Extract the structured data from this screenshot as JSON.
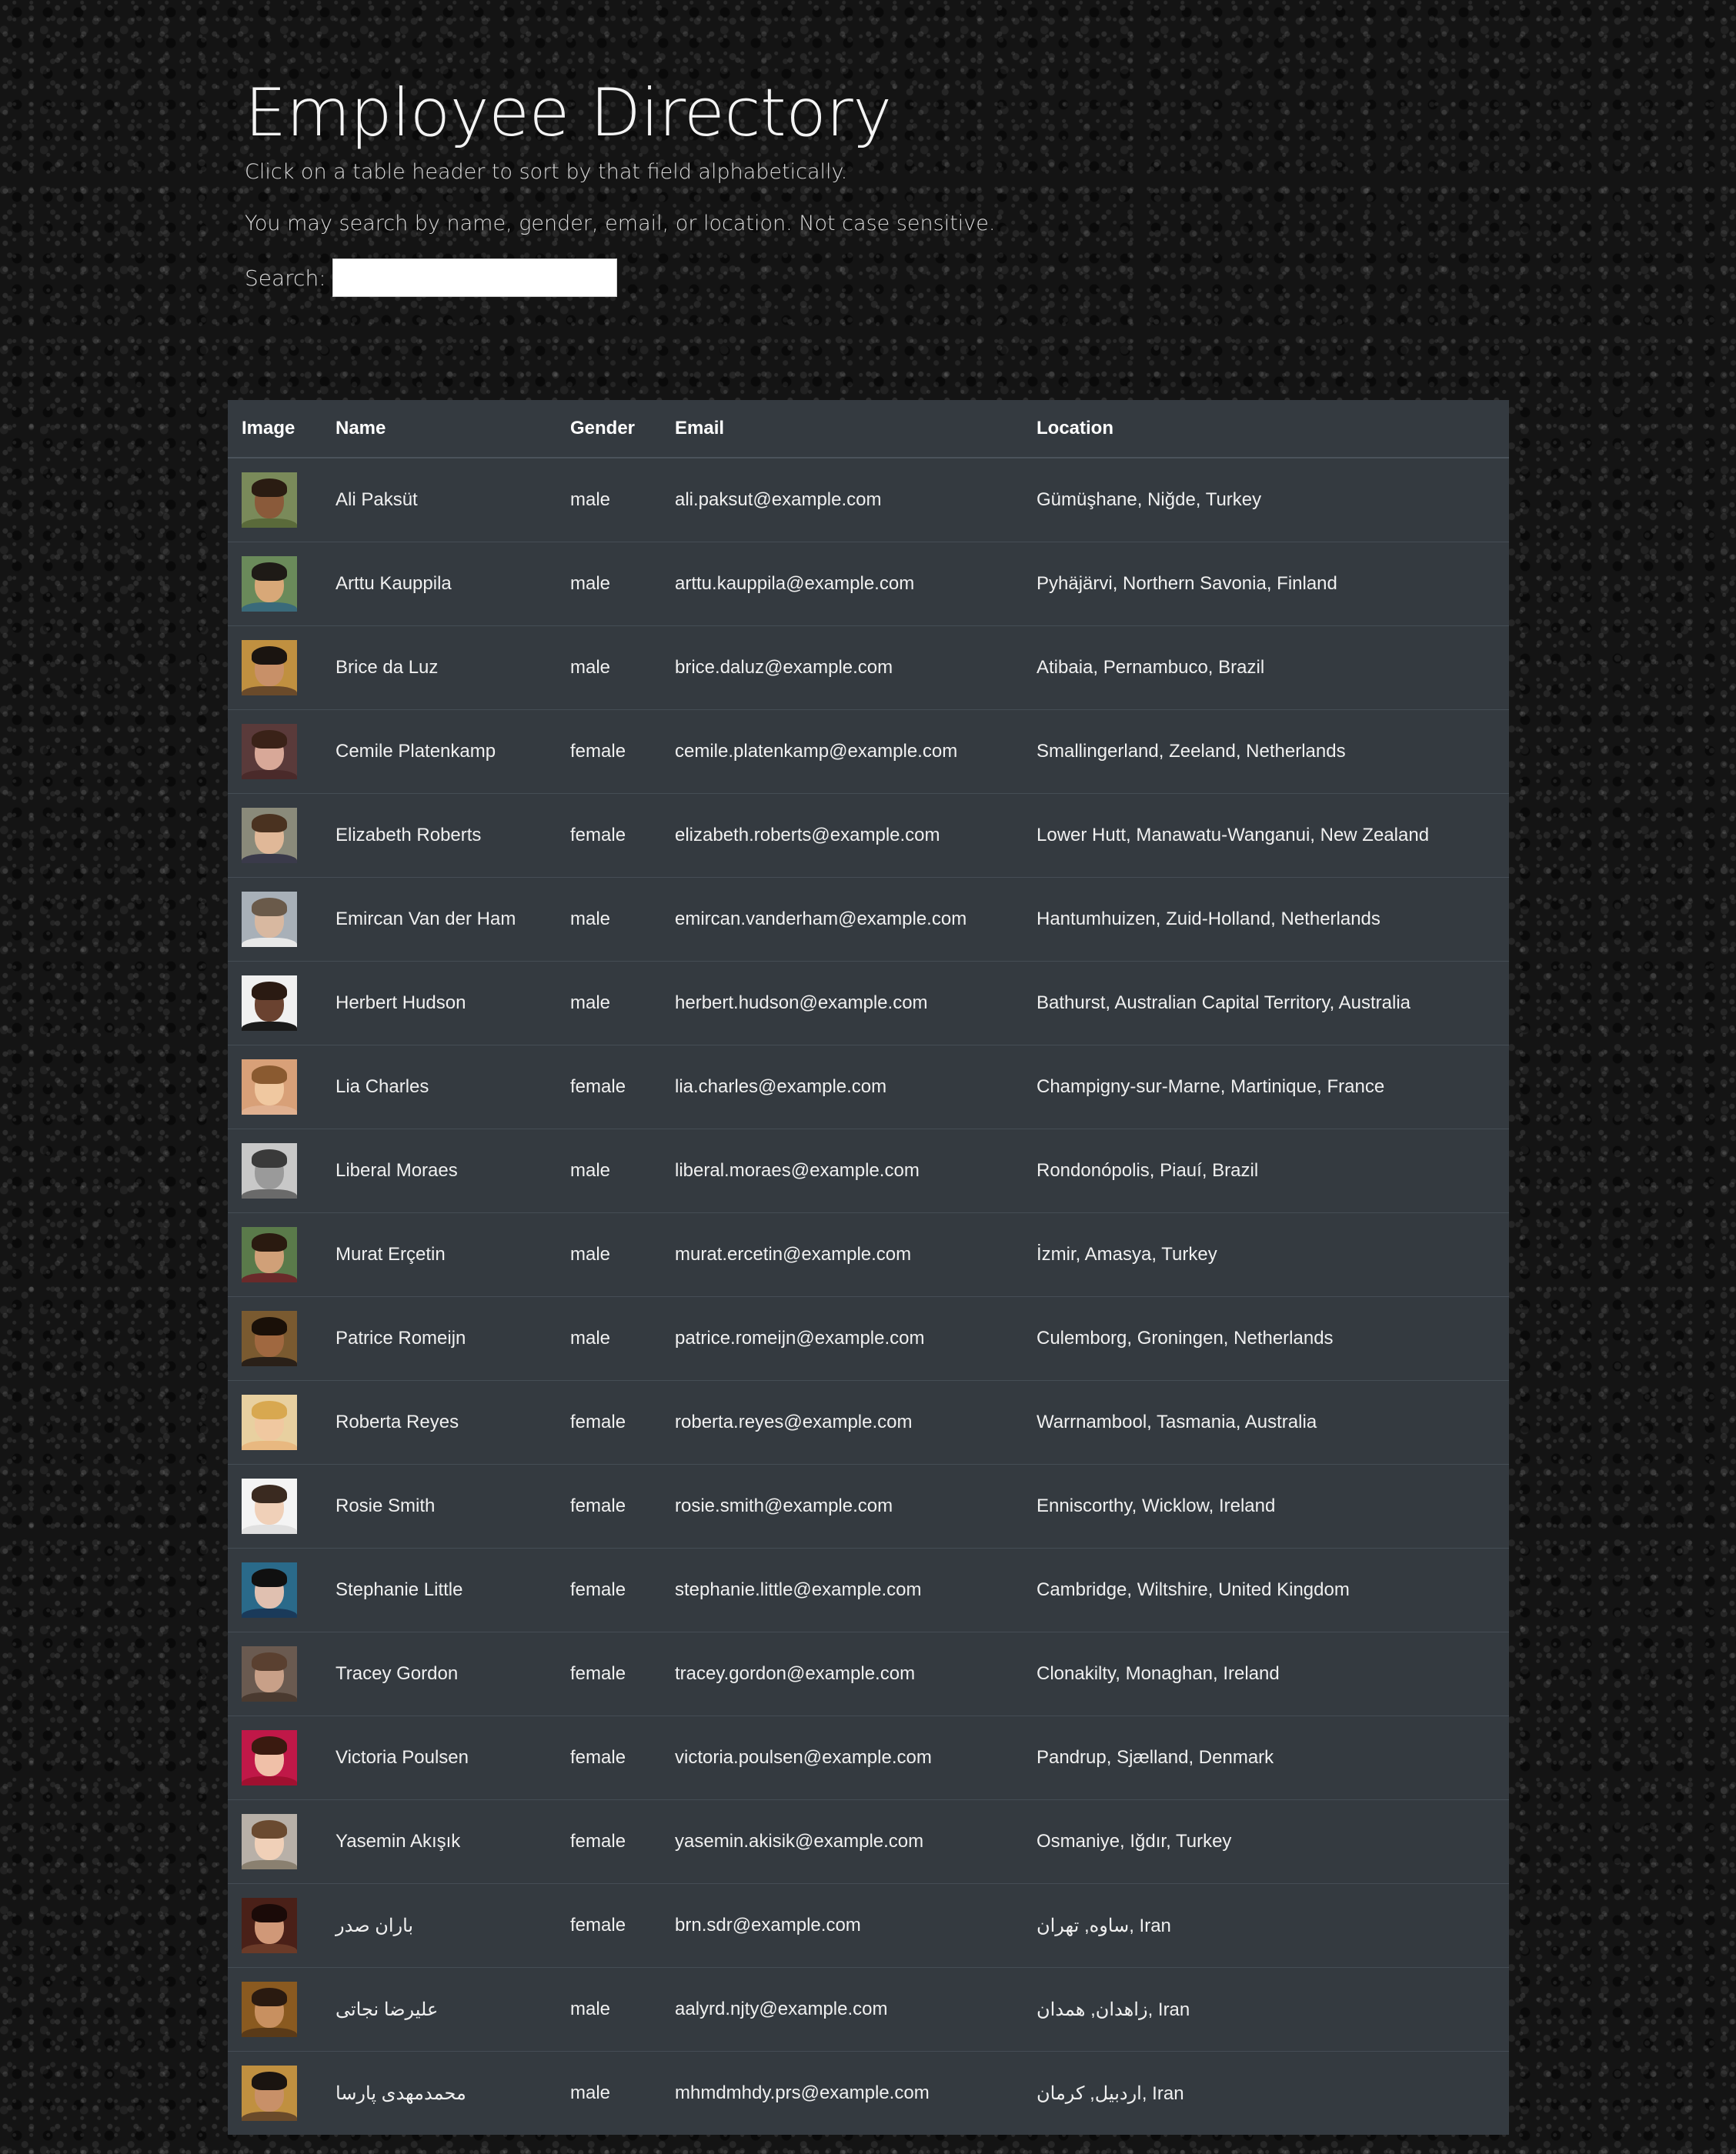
{
  "header": {
    "title": "Employee Directory",
    "instruction": "Click on a table header to sort by that field alphabetically.",
    "search_help": "You may search by name, gender, email, or location. Not case sensitive.",
    "search_label": "Search:",
    "search_value": "",
    "search_placeholder": ""
  },
  "table": {
    "columns": [
      "Image",
      "Name",
      "Gender",
      "Email",
      "Location"
    ],
    "rows": [
      {
        "name": "Ali Paksüt",
        "gender": "male",
        "email": "ali.paksut@example.com",
        "location": "Gümüşhane, Niğde, Turkey",
        "avatar": {
          "bg": "#7a8a5a",
          "skin": "#8a5a3a",
          "hair": "#2a1c12",
          "shirt": "#5a6a3a"
        }
      },
      {
        "name": "Arttu Kauppila",
        "gender": "male",
        "email": "arttu.kauppila@example.com",
        "location": "Pyhäjärvi, Northern Savonia, Finland",
        "avatar": {
          "bg": "#6a8a5a",
          "skin": "#d8a878",
          "hair": "#1e1a16",
          "shirt": "#3a6a7a"
        }
      },
      {
        "name": "Brice da Luz",
        "gender": "male",
        "email": "brice.daluz@example.com",
        "location": "Atibaia, Pernambuco, Brazil",
        "avatar": {
          "bg": "#c09040",
          "skin": "#c89068",
          "hair": "#1a1410",
          "shirt": "#6a4a2a"
        }
      },
      {
        "name": "Cemile Platenkamp",
        "gender": "female",
        "email": "cemile.platenkamp@example.com",
        "location": "Smallingerland, Zeeland, Netherlands",
        "avatar": {
          "bg": "#5a3a3a",
          "skin": "#d8a898",
          "hair": "#3a2218",
          "shirt": "#4a2a2a"
        }
      },
      {
        "name": "Elizabeth Roberts",
        "gender": "female",
        "email": "elizabeth.roberts@example.com",
        "location": "Lower Hutt, Manawatu-Wanganui, New Zealand",
        "avatar": {
          "bg": "#8a8a7a",
          "skin": "#e0b898",
          "hair": "#4a3220",
          "shirt": "#3a3a4a"
        }
      },
      {
        "name": "Emircan Van der Ham",
        "gender": "male",
        "email": "emircan.vanderham@example.com",
        "location": "Hantumhuizen, Zuid-Holland, Netherlands",
        "avatar": {
          "bg": "#a8b0b8",
          "skin": "#d8b8a0",
          "hair": "#6a5a4a",
          "shirt": "#e8e8e8"
        }
      },
      {
        "name": "Herbert Hudson",
        "gender": "male",
        "email": "herbert.hudson@example.com",
        "location": "Bathurst, Australian Capital Territory, Australia",
        "avatar": {
          "bg": "#f0f0f0",
          "skin": "#6a4230",
          "hair": "#2a1a12",
          "shirt": "#1a1a1a"
        }
      },
      {
        "name": "Lia Charles",
        "gender": "female",
        "email": "lia.charles@example.com",
        "location": "Champigny-sur-Marne, Martinique, France",
        "avatar": {
          "bg": "#d8a078",
          "skin": "#f0c8a0",
          "hair": "#8a5a30",
          "shirt": "#e0b090"
        }
      },
      {
        "name": "Liberal Moraes",
        "gender": "male",
        "email": "liberal.moraes@example.com",
        "location": "Rondonópolis, Piauí, Brazil",
        "avatar": {
          "bg": "#c8c8c8",
          "skin": "#9a9a9a",
          "hair": "#3a3a3a",
          "shirt": "#6a6a6a"
        }
      },
      {
        "name": "Murat Erçetin",
        "gender": "male",
        "email": "murat.ercetin@example.com",
        "location": "İzmir, Amasya, Turkey",
        "avatar": {
          "bg": "#5a7a4a",
          "skin": "#d0a078",
          "hair": "#2a1a10",
          "shirt": "#6a2a2a"
        }
      },
      {
        "name": "Patrice Romeijn",
        "gender": "male",
        "email": "patrice.romeijn@example.com",
        "location": "Culemborg, Groningen, Netherlands",
        "avatar": {
          "bg": "#7a5a30",
          "skin": "#a06840",
          "hair": "#1a1008",
          "shirt": "#2a2018"
        }
      },
      {
        "name": "Roberta Reyes",
        "gender": "female",
        "email": "roberta.reyes@example.com",
        "location": "Warrnambool, Tasmania, Australia",
        "avatar": {
          "bg": "#e8d0a0",
          "skin": "#f0c8a0",
          "hair": "#d8a850",
          "shirt": "#e8b880"
        }
      },
      {
        "name": "Rosie Smith",
        "gender": "female",
        "email": "rosie.smith@example.com",
        "location": "Enniscorthy, Wicklow, Ireland",
        "avatar": {
          "bg": "#f4f4f4",
          "skin": "#f0d0b8",
          "hair": "#3a2a20",
          "shirt": "#e0e0e0"
        }
      },
      {
        "name": "Stephanie Little",
        "gender": "female",
        "email": "stephanie.little@example.com",
        "location": "Cambridge, Wiltshire, United Kingdom",
        "avatar": {
          "bg": "#2a6a8a",
          "skin": "#e0c0b0",
          "hair": "#101010",
          "shirt": "#1a3a5a"
        }
      },
      {
        "name": "Tracey Gordon",
        "gender": "female",
        "email": "tracey.gordon@example.com",
        "location": "Clonakilty, Monaghan, Ireland",
        "avatar": {
          "bg": "#6a5a50",
          "skin": "#c8a088",
          "hair": "#5a4030",
          "shirt": "#4a3a30"
        }
      },
      {
        "name": "Victoria Poulsen",
        "gender": "female",
        "email": "victoria.poulsen@example.com",
        "location": "Pandrup, Sjælland, Denmark",
        "avatar": {
          "bg": "#c01848",
          "skin": "#f0c0a8",
          "hair": "#3a1a10",
          "shirt": "#a01030"
        }
      },
      {
        "name": "Yasemin Akışık",
        "gender": "female",
        "email": "yasemin.akisik@example.com",
        "location": "Osmaniye, Iğdır, Turkey",
        "avatar": {
          "bg": "#b8b0a8",
          "skin": "#f0d0b8",
          "hair": "#6a4a30",
          "shirt": "#8a8070"
        }
      },
      {
        "name": "باران صدر",
        "gender": "female",
        "email": "brn.sdr@example.com",
        "location": "ساوه, تهران, Iran",
        "avatar": {
          "bg": "#4a2018",
          "skin": "#d09878",
          "hair": "#1a0a08",
          "shirt": "#6a3a28"
        }
      },
      {
        "name": "عليرضا نجاتی",
        "gender": "male",
        "email": "aalyrd.njty@example.com",
        "location": "زاهدان, همدان, Iran",
        "avatar": {
          "bg": "#8a5a20",
          "skin": "#c89060",
          "hair": "#2a1a10",
          "shirt": "#5a3a18"
        }
      },
      {
        "name": "محمدمهدی پارسا",
        "gender": "male",
        "email": "mhmdmhdy.prs@example.com",
        "location": "اردبیل, کرمان, Iran",
        "avatar": {
          "bg": "#c09040",
          "skin": "#c89068",
          "hair": "#1a1410",
          "shirt": "#6a4a2a"
        }
      }
    ]
  }
}
